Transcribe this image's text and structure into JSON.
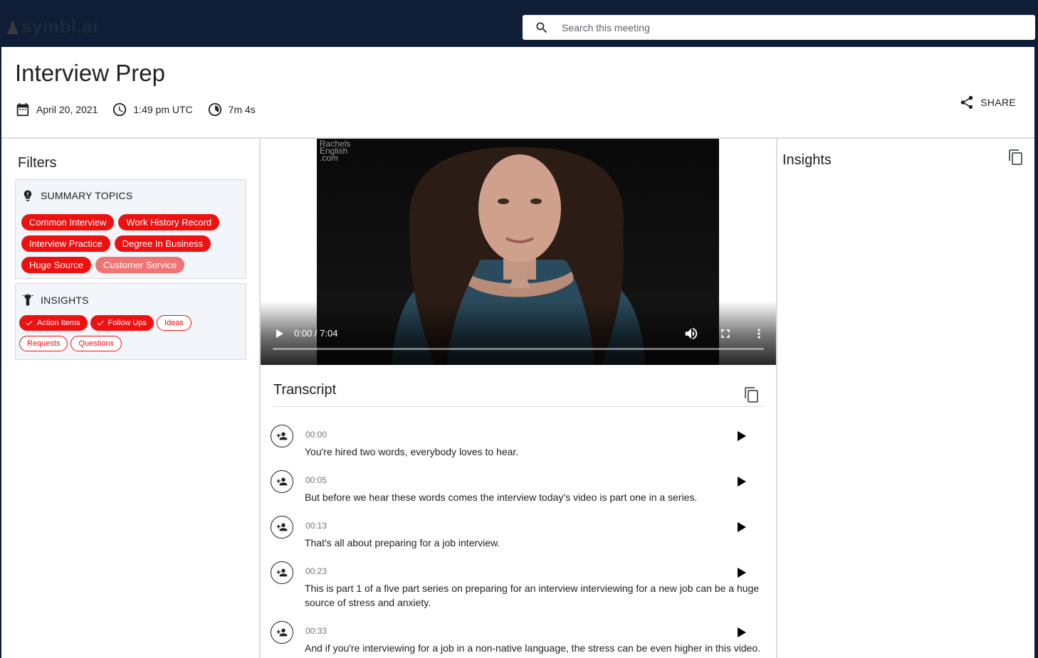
{
  "app": {
    "logo_text": "symbl.ai"
  },
  "search": {
    "placeholder": "Search this meeting",
    "value": ""
  },
  "meeting": {
    "title": "Interview Prep",
    "date": "April 20, 2021",
    "time": "1:49 pm UTC",
    "duration": "7m 4s",
    "share_label": "SHARE"
  },
  "filters": {
    "heading": "Filters",
    "summary_topics": {
      "heading": "SUMMARY TOPICS",
      "topics": [
        {
          "label": "Common Interview"
        },
        {
          "label": "Work History Record"
        },
        {
          "label": "Interview Practice"
        },
        {
          "label": "Degree In Business"
        },
        {
          "label": "Huge Source"
        },
        {
          "label": "Customer Service"
        }
      ]
    },
    "insights": {
      "heading": "INSIGHTS",
      "types": [
        {
          "label": "Action Items",
          "selected": true
        },
        {
          "label": "Follow Ups",
          "selected": true
        },
        {
          "label": "Ideas",
          "selected": false
        },
        {
          "label": "Requests",
          "selected": false
        },
        {
          "label": "Questions",
          "selected": false
        }
      ]
    }
  },
  "video": {
    "watermark": [
      "Rachels",
      "English",
      ".com"
    ],
    "time_display": "0:00 / 7:04",
    "progress": 0
  },
  "transcript": {
    "heading": "Transcript",
    "lines": [
      {
        "time": "00:00",
        "text": "You're hired two words, everybody loves to hear."
      },
      {
        "time": "00:05",
        "text": "But before we hear these words comes the interview today's video is part one in a series."
      },
      {
        "time": "00:13",
        "text": "That's all about preparing for a job interview."
      },
      {
        "time": "00:23",
        "text": "This is part 1 of a five part series on preparing for an interview interviewing for a new job can be a huge source of stress and anxiety."
      },
      {
        "time": "00:33",
        "text": "And if you're interviewing for a job in a non-native language, the stress can be even higher in this video."
      }
    ]
  },
  "insights_panel": {
    "heading": "Insights"
  },
  "colors": {
    "navy": "#0f1e36",
    "chip_red": "#ee1111",
    "chip_light": "#f07474"
  }
}
